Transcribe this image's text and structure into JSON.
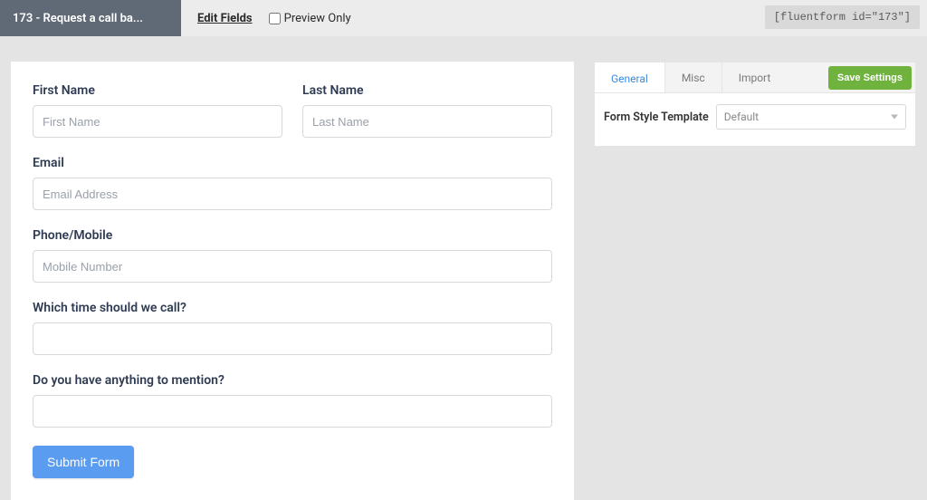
{
  "topbar": {
    "title": "173 - Request a call ba...",
    "edit_fields": "Edit Fields",
    "preview_only": "Preview Only",
    "shortcode": "[fluentform id=\"173\"]"
  },
  "form": {
    "first_name": {
      "label": "First Name",
      "placeholder": "First Name"
    },
    "last_name": {
      "label": "Last Name",
      "placeholder": "Last Name"
    },
    "email": {
      "label": "Email",
      "placeholder": "Email Address"
    },
    "phone": {
      "label": "Phone/Mobile",
      "placeholder": "Mobile Number"
    },
    "time": {
      "label": "Which time should we call?"
    },
    "message": {
      "label": "Do you have anything to mention?"
    },
    "submit": "Submit Form"
  },
  "settings": {
    "tabs": {
      "general": "General",
      "misc": "Misc",
      "import": "Import"
    },
    "save": "Save Settings",
    "style_label": "Form Style Template",
    "style_value": "Default"
  }
}
